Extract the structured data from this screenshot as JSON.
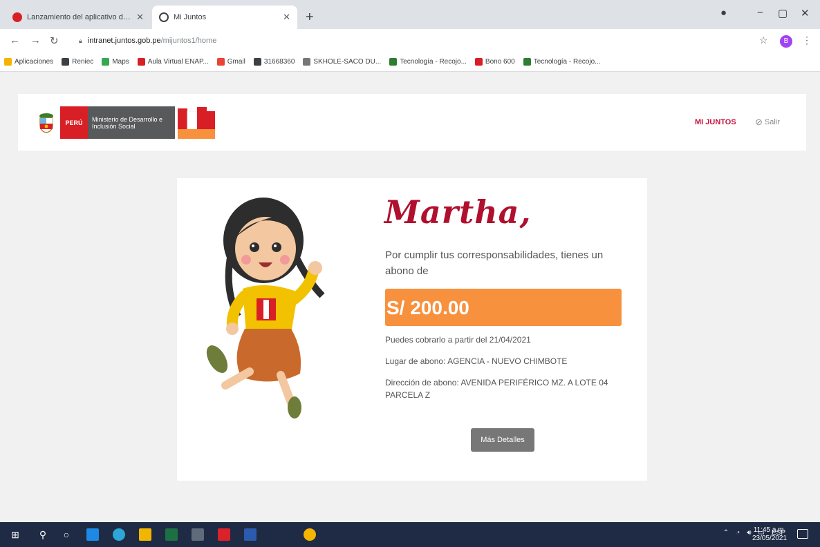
{
  "browser": {
    "tabs": [
      {
        "title": "Lanzamiento del aplicativo de ...",
        "active": false,
        "favicon_color": "#d91f26"
      },
      {
        "title": "Mi Juntos",
        "active": true,
        "favicon_color": "#3c4043"
      }
    ],
    "url_host": "intranet.juntos.gob.pe",
    "url_path": "/mijuntos1/home",
    "profile_initial": "B",
    "bookmarks": [
      {
        "label": "Aplicaciones",
        "icon": "apps-grid-icon",
        "color": "#f4b400"
      },
      {
        "label": "Reniec",
        "icon": "globe-icon",
        "color": "#3c4043"
      },
      {
        "label": "Maps",
        "icon": "maps-pin-icon",
        "color": "#34a853"
      },
      {
        "label": "Aula Virtual ENAP...",
        "icon": "enap-icon",
        "color": "#d91f26"
      },
      {
        "label": "Gmail",
        "icon": "gmail-icon",
        "color": "#ea4335"
      },
      {
        "label": "31668360",
        "icon": "globe-icon",
        "color": "#3c4043"
      },
      {
        "label": "SKHOLE-SACO DU...",
        "icon": "skhole-icon",
        "color": "#777777"
      },
      {
        "label": "Tecnología - Recojo...",
        "icon": "tech-icon",
        "color": "#2e7d32"
      },
      {
        "label": "Bono 600",
        "icon": "peru-icon",
        "color": "#d91f26"
      },
      {
        "label": "Tecnología - Recojo...",
        "icon": "tech-icon",
        "color": "#2e7d32"
      }
    ]
  },
  "header": {
    "peru_label": "PERÚ",
    "midis_label": "Ministerio de Desarrollo e Inclusión Social",
    "nav_mijuntos": "MI JUNTOS",
    "nav_salir": "Salir"
  },
  "card": {
    "greeting": "Martha,",
    "message": "Por cumplir tus corresponsabilidades, tienes un abono de",
    "amount": "S/ 200.00",
    "collect_from": "Puedes cobrarlo a partir del 21/04/2021",
    "location": "Lugar de abono: AGENCIA - NUEVO CHIMBOTE",
    "address": "Dirección de abono: AVENIDA PERIFÉRICO MZ. A LOTE 04 PARCELA Z",
    "details_button": "Más Detalles"
  },
  "taskbar": {
    "tray_lang": "ESP",
    "time": "11:45 a.m.",
    "date": "23/05/2021"
  },
  "colors": {
    "accent_red": "#b0102e",
    "amount_orange": "#f7913d",
    "button_gray": "#777777"
  }
}
